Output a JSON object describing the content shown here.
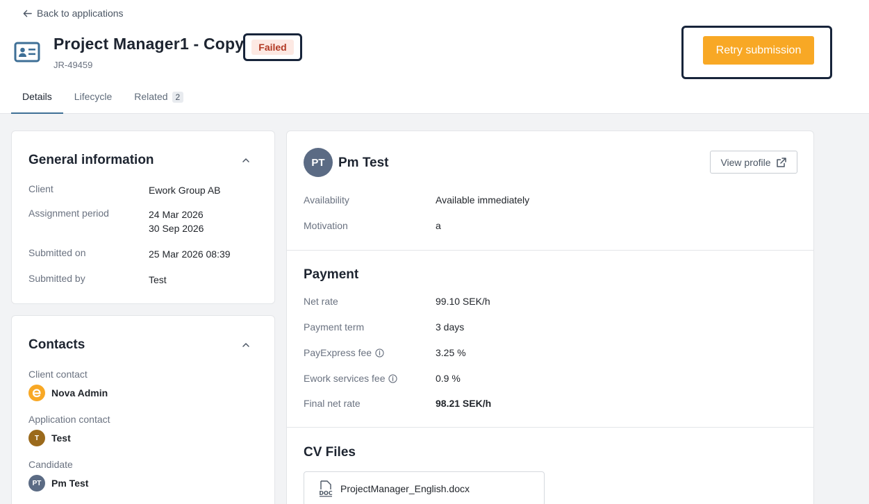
{
  "header": {
    "back_label": "Back to applications",
    "title": "Project Manager1 - Copy",
    "reference": "JR-49459",
    "status": "Failed",
    "retry_label": "Retry submission"
  },
  "tabs": [
    {
      "label": "Details",
      "active": true
    },
    {
      "label": "Lifecycle"
    },
    {
      "label": "Related",
      "count": "2"
    }
  ],
  "general": {
    "title": "General information",
    "rows": [
      {
        "label": "Client",
        "value": "Ework Group AB"
      },
      {
        "label": "Assignment period",
        "value": "24 Mar 2026",
        "value2": "30 Sep 2026"
      },
      {
        "label": "Submitted on",
        "value": "25 Mar 2026 08:39"
      },
      {
        "label": "Submitted by",
        "value": "Test"
      }
    ]
  },
  "contacts": {
    "title": "Contacts",
    "items": [
      {
        "label": "Client contact",
        "name": "Nova Admin",
        "avatar": "ework-logo-icon"
      },
      {
        "label": "Application contact",
        "name": "Test",
        "initials": "T"
      },
      {
        "label": "Candidate",
        "name": "Pm Test",
        "initials": "PT"
      }
    ]
  },
  "candidate": {
    "initials": "PT",
    "name": "Pm Test",
    "view_profile_label": "View profile",
    "rows": [
      {
        "label": "Availability",
        "value": "Available immediately"
      },
      {
        "label": "Motivation",
        "value": "a"
      }
    ]
  },
  "payment": {
    "title": "Payment",
    "rows": [
      {
        "label": "Net rate",
        "value": "99.10 SEK/h"
      },
      {
        "label": "Payment term",
        "value": "3 days"
      },
      {
        "label": "PayExpress fee",
        "value": "3.25 %",
        "info": true
      },
      {
        "label": "Ework services fee",
        "value": "0.9 %",
        "info": true
      },
      {
        "label": "Final net rate",
        "value": "98.21 SEK/h",
        "bold": true
      }
    ]
  },
  "cv": {
    "title": "CV Files",
    "file_name": "ProjectManager_English.docx"
  },
  "colors": {
    "accent": "#f8a825",
    "status_bg": "#fde9e3",
    "status_text": "#b23a24",
    "tab_underline": "#3e6f96"
  }
}
